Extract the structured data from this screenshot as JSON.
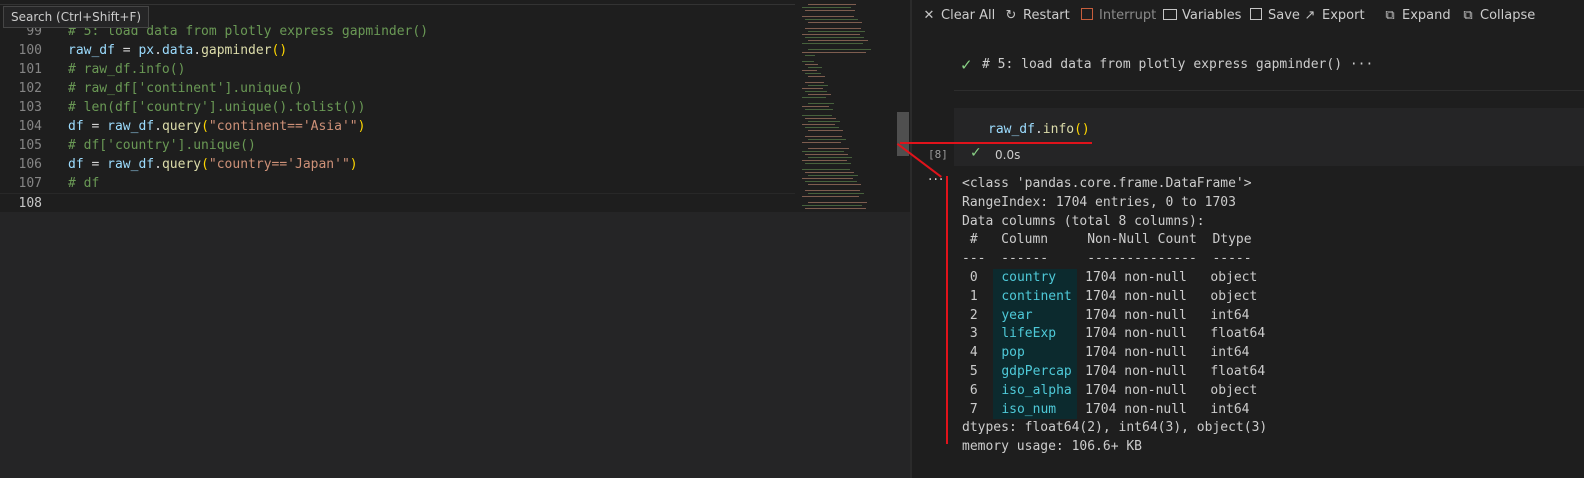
{
  "tooltip": "Search (Ctrl+Shift+F)",
  "editor": {
    "lines": [
      {
        "num": "99",
        "parts": [
          {
            "t": "# 5: load data from plotly express gapminder()",
            "c": "cm"
          }
        ]
      },
      {
        "num": "100",
        "parts": [
          {
            "t": "raw_df",
            "c": "var"
          },
          {
            "t": " = ",
            "c": ""
          },
          {
            "t": "px",
            "c": "var"
          },
          {
            "t": ".",
            "c": ""
          },
          {
            "t": "data",
            "c": "var"
          },
          {
            "t": ".",
            "c": ""
          },
          {
            "t": "gapminder",
            "c": "fn"
          },
          {
            "t": "()",
            "c": "par"
          }
        ]
      },
      {
        "num": "101",
        "parts": [
          {
            "t": "# raw_df.info()",
            "c": "cm"
          }
        ]
      },
      {
        "num": "102",
        "parts": [
          {
            "t": "# raw_df['continent'].unique()",
            "c": "cm"
          }
        ]
      },
      {
        "num": "103",
        "parts": [
          {
            "t": "# len(df['country'].unique().tolist())",
            "c": "cm"
          }
        ]
      },
      {
        "num": "104",
        "parts": [
          {
            "t": "df",
            "c": "var"
          },
          {
            "t": " = ",
            "c": ""
          },
          {
            "t": "raw_df",
            "c": "var"
          },
          {
            "t": ".",
            "c": ""
          },
          {
            "t": "query",
            "c": "fn"
          },
          {
            "t": "(",
            "c": "par"
          },
          {
            "t": "\"continent=='Asia'\"",
            "c": "str"
          },
          {
            "t": ")",
            "c": "par"
          }
        ]
      },
      {
        "num": "105",
        "parts": [
          {
            "t": "# df['country'].unique()",
            "c": "cm"
          }
        ]
      },
      {
        "num": "106",
        "parts": [
          {
            "t": "df",
            "c": "var"
          },
          {
            "t": " = ",
            "c": ""
          },
          {
            "t": "raw_df",
            "c": "var"
          },
          {
            "t": ".",
            "c": ""
          },
          {
            "t": "query",
            "c": "fn"
          },
          {
            "t": "(",
            "c": "par"
          },
          {
            "t": "\"country=='Japan'\"",
            "c": "str"
          },
          {
            "t": ")",
            "c": "par"
          }
        ]
      },
      {
        "num": "107",
        "parts": [
          {
            "t": "# df",
            "c": "cm"
          }
        ]
      },
      {
        "num": "108",
        "parts": [],
        "active": true
      }
    ]
  },
  "toolbar": {
    "clear_all": "Clear All",
    "restart": "Restart",
    "interrupt": "Interrupt",
    "variables": "Variables",
    "save": "Save",
    "export": "Export",
    "expand": "Expand",
    "collapse": "Collapse"
  },
  "cells": {
    "collapsed_cell": "# 5: load data from plotly express gapminder()",
    "collapsed_more": "···",
    "code_cell": {
      "fn": "raw_df",
      "dot": ".",
      "method": "info",
      "parens": "()"
    },
    "exec_count": "[8]",
    "exec_time": "0.0s"
  },
  "output": {
    "header": [
      "<class 'pandas.core.frame.DataFrame'>",
      "RangeIndex: 1704 entries, 0 to 1703",
      "Data columns (total 8 columns):",
      " #   Column     Non-Null Count  Dtype  ",
      "---  ------     --------------  -----  "
    ],
    "rows": [
      {
        "idx": " 0 ",
        "col": "country",
        "count": "1704 non-null",
        "dtype": "object"
      },
      {
        "idx": " 1 ",
        "col": "continent",
        "count": "1704 non-null",
        "dtype": "object"
      },
      {
        "idx": " 2 ",
        "col": "year",
        "count": "1704 non-null",
        "dtype": "int64"
      },
      {
        "idx": " 3 ",
        "col": "lifeExp",
        "count": "1704 non-null",
        "dtype": "float64"
      },
      {
        "idx": " 4 ",
        "col": "pop",
        "count": "1704 non-null",
        "dtype": "int64"
      },
      {
        "idx": " 5 ",
        "col": "gdpPercap",
        "count": "1704 non-null",
        "dtype": "float64"
      },
      {
        "idx": " 6 ",
        "col": "iso_alpha",
        "count": "1704 non-null",
        "dtype": "object"
      },
      {
        "idx": " 7 ",
        "col": "iso_num",
        "count": "1704 non-null",
        "dtype": "int64"
      }
    ],
    "footer": [
      "dtypes: float64(2), int64(3), object(3)",
      "memory usage: 106.6+ KB"
    ]
  },
  "colors": {
    "annotation_red": "#e0131b",
    "success_green": "#89d185"
  }
}
